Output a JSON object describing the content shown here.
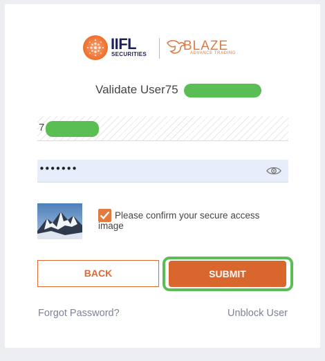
{
  "logo": {
    "brand": "IIFL",
    "sub": "SECURITIES",
    "product": "BLAZE",
    "tagline": "ADVANCE TRADING"
  },
  "title": "Validate User75",
  "user_field": {
    "value": "7"
  },
  "password_field": {
    "value": "•••••••"
  },
  "secure_confirm": {
    "checked": true,
    "label": "Please confirm your secure access image"
  },
  "buttons": {
    "back": "BACK",
    "submit": "SUBMIT"
  },
  "links": {
    "forgot": "Forgot Password?",
    "unblock": "Unblock User"
  },
  "colors": {
    "accent": "#e0692f",
    "submit_bg": "#d9662d",
    "highlight": "#5bbe55",
    "password_bg": "#e8edfb",
    "link": "#7d8398"
  },
  "icons": {
    "eye": "eye-icon",
    "check": "check-icon"
  }
}
